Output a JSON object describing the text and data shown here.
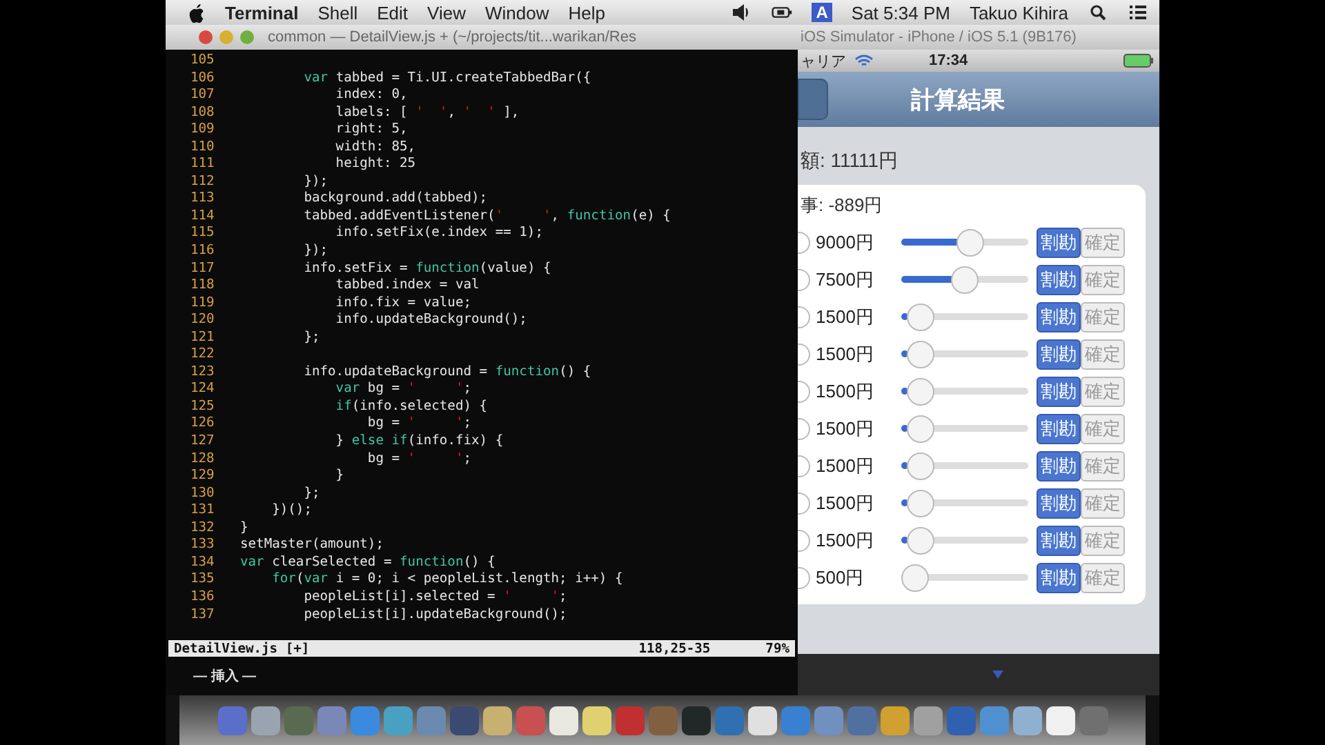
{
  "menu_bar": {
    "app": "Terminal",
    "menus": [
      "Shell",
      "Edit",
      "View",
      "Window",
      "Help"
    ],
    "input_indicator": "A",
    "clock": "Sat 5:34 PM",
    "user": "Takuo Kihira"
  },
  "terminal": {
    "title": "common — DetailView.js + (~/projects/tit...warikan/Res",
    "lines": [
      {
        "number": "105"
      },
      {
        "number": "106",
        "segments": [
          {
            "kind": "kw",
            "text": "        var"
          },
          {
            "kind": "plain",
            "text": " tabbed = Ti.UI.createTabbedBar({"
          }
        ]
      },
      {
        "number": "107",
        "segments": [
          {
            "kind": "plain",
            "text": "            index: 0,"
          }
        ]
      },
      {
        "number": "108",
        "segments": [
          {
            "kind": "plain",
            "text": "            labels: [ "
          },
          {
            "kind": "str",
            "text": "'  '"
          },
          {
            "kind": "plain",
            "text": ", "
          },
          {
            "kind": "str",
            "text": "'  '"
          },
          {
            "kind": "plain",
            "text": " ],"
          }
        ]
      },
      {
        "number": "109",
        "segments": [
          {
            "kind": "plain",
            "text": "            right: 5,"
          }
        ]
      },
      {
        "number": "110",
        "segments": [
          {
            "kind": "plain",
            "text": "            width: 85,"
          }
        ]
      },
      {
        "number": "111",
        "segments": [
          {
            "kind": "plain",
            "text": "            height: 25"
          }
        ]
      },
      {
        "number": "112",
        "segments": [
          {
            "kind": "plain",
            "text": "        });"
          }
        ]
      },
      {
        "number": "113",
        "segments": [
          {
            "kind": "plain",
            "text": "        background.add(tabbed);"
          }
        ]
      },
      {
        "number": "114",
        "segments": [
          {
            "kind": "plain",
            "text": "        tabbed.addEventListener("
          },
          {
            "kind": "str",
            "text": "'     '"
          },
          {
            "kind": "plain",
            "text": ", "
          },
          {
            "kind": "kw",
            "text": "function"
          },
          {
            "kind": "plain",
            "text": "(e) {"
          }
        ]
      },
      {
        "number": "115",
        "segments": [
          {
            "kind": "plain",
            "text": "            info.setFix(e.index == 1);"
          }
        ]
      },
      {
        "number": "116",
        "segments": [
          {
            "kind": "plain",
            "text": "        });"
          }
        ]
      },
      {
        "number": "117",
        "segments": [
          {
            "kind": "plain",
            "text": "        info.setFix = "
          },
          {
            "kind": "kw",
            "text": "function"
          },
          {
            "kind": "plain",
            "text": "(value) {"
          }
        ]
      },
      {
        "number": "118",
        "segments": [
          {
            "kind": "plain",
            "text": "            tabbed.index = val"
          }
        ]
      },
      {
        "number": "119",
        "segments": [
          {
            "kind": "plain",
            "text": "            info.fix = value;"
          }
        ]
      },
      {
        "number": "120",
        "segments": [
          {
            "kind": "plain",
            "text": "            info.updateBackground();"
          }
        ]
      },
      {
        "number": "121",
        "segments": [
          {
            "kind": "plain",
            "text": "        };"
          }
        ]
      },
      {
        "number": "122"
      },
      {
        "number": "123",
        "segments": [
          {
            "kind": "plain",
            "text": "        info.updateBackground = "
          },
          {
            "kind": "kw",
            "text": "function"
          },
          {
            "kind": "plain",
            "text": "() {"
          }
        ]
      },
      {
        "number": "124",
        "segments": [
          {
            "kind": "kw",
            "text": "            var"
          },
          {
            "kind": "plain",
            "text": " bg = "
          },
          {
            "kind": "str",
            "text": "'     '"
          },
          {
            "kind": "plain",
            "text": ";"
          }
        ]
      },
      {
        "number": "125",
        "segments": [
          {
            "kind": "kw",
            "text": "            if"
          },
          {
            "kind": "plain",
            "text": "(info.selected) {"
          }
        ]
      },
      {
        "number": "126",
        "segments": [
          {
            "kind": "plain",
            "text": "                bg = "
          },
          {
            "kind": "str",
            "text": "'     '"
          },
          {
            "kind": "plain",
            "text": ";"
          }
        ]
      },
      {
        "number": "127",
        "segments": [
          {
            "kind": "plain",
            "text": "            } "
          },
          {
            "kind": "kw",
            "text": "else if"
          },
          {
            "kind": "plain",
            "text": "(info.fix) {"
          }
        ]
      },
      {
        "number": "128",
        "segments": [
          {
            "kind": "plain",
            "text": "                bg = "
          },
          {
            "kind": "str",
            "text": "'     '"
          },
          {
            "kind": "plain",
            "text": ";"
          }
        ]
      },
      {
        "number": "129",
        "segments": [
          {
            "kind": "plain",
            "text": "            }"
          }
        ]
      },
      {
        "number": "130",
        "segments": [
          {
            "kind": "plain",
            "text": "        };"
          }
        ]
      },
      {
        "number": "131",
        "segments": [
          {
            "kind": "plain",
            "text": "    })();"
          }
        ]
      },
      {
        "number": "132",
        "segments": [
          {
            "kind": "plain",
            "text": "}"
          }
        ]
      },
      {
        "number": "133",
        "segments": [
          {
            "kind": "plain",
            "text": "setMaster(amount);"
          }
        ]
      },
      {
        "number": "134",
        "segments": [
          {
            "kind": "kw",
            "text": "var"
          },
          {
            "kind": "plain",
            "text": " clearSelected = "
          },
          {
            "kind": "kw",
            "text": "function"
          },
          {
            "kind": "plain",
            "text": "() {"
          }
        ]
      },
      {
        "number": "135",
        "segments": [
          {
            "kind": "kw",
            "text": "    for"
          },
          {
            "kind": "plain",
            "text": "("
          },
          {
            "kind": "kw",
            "text": "var"
          },
          {
            "kind": "plain",
            "text": " i = 0; i < peopleList.length; i++) {"
          }
        ]
      },
      {
        "number": "136",
        "segments": [
          {
            "kind": "plain",
            "text": "        peopleList[i].selected = "
          },
          {
            "kind": "str",
            "text": "'     '"
          },
          {
            "kind": "plain",
            "text": ";"
          }
        ]
      },
      {
        "number": "137",
        "segments": [
          {
            "kind": "plain",
            "text": "        peopleList[i].updateBackground();"
          }
        ]
      }
    ],
    "status_file": "DetailView.js [+]",
    "status_position": "118,25-35",
    "status_percent": "79%",
    "mode": "— 挿入 —"
  },
  "simulator": {
    "title": "iOS Simulator - iPhone / iOS 5.1 (9B176)",
    "carrier": "ャリア",
    "time": "17:34",
    "nav_title": "計算結果",
    "total": "額: 11111円",
    "organizer": "事: -889円",
    "rows": [
      {
        "amount": "9000円",
        "level": 0.55,
        "selected": false,
        "buttons": [
          {
            "label": "割勘",
            "selected": true
          },
          {
            "label": "確定",
            "selected": false
          }
        ]
      },
      {
        "amount": "7500円",
        "level": 0.5,
        "selected": false,
        "buttons": [
          {
            "label": "割勘",
            "selected": true
          },
          {
            "label": "確定",
            "selected": false
          }
        ]
      },
      {
        "amount": "1500円",
        "level": 0.05,
        "selected": false,
        "buttons": [
          {
            "label": "割勘",
            "selected": true
          },
          {
            "label": "確定",
            "selected": false
          }
        ]
      },
      {
        "amount": "1500円",
        "level": 0.05,
        "selected": false,
        "buttons": [
          {
            "label": "割勘",
            "selected": true
          },
          {
            "label": "確定",
            "selected": false
          }
        ]
      },
      {
        "amount": "1500円",
        "level": 0.05,
        "selected": false,
        "buttons": [
          {
            "label": "割勘",
            "selected": true
          },
          {
            "label": "確定",
            "selected": false
          }
        ]
      },
      {
        "amount": "1500円",
        "level": 0.05,
        "selected": false,
        "buttons": [
          {
            "label": "割勘",
            "selected": true
          },
          {
            "label": "確定",
            "selected": false
          }
        ]
      },
      {
        "amount": "1500円",
        "level": 0.05,
        "selected": false,
        "buttons": [
          {
            "label": "割勘",
            "selected": true
          },
          {
            "label": "確定",
            "selected": false
          }
        ]
      },
      {
        "amount": "1500円",
        "level": 0.05,
        "selected": false,
        "buttons": [
          {
            "label": "割勘",
            "selected": true
          },
          {
            "label": "確定",
            "selected": false
          }
        ]
      },
      {
        "amount": "1500円",
        "level": 0.05,
        "selected": false,
        "buttons": [
          {
            "label": "割勘",
            "selected": true
          },
          {
            "label": "確定",
            "selected": false
          }
        ]
      },
      {
        "amount": "500円",
        "level": 0.0,
        "selected": false,
        "buttons": [
          {
            "label": "割勘",
            "selected": true
          },
          {
            "label": "確定",
            "selected": false
          }
        ]
      }
    ]
  },
  "dock": [
    {
      "color": "#5a6fc8"
    },
    {
      "color": "#9aa4b0"
    },
    {
      "color": "#5a6a50"
    },
    {
      "color": "#7a88b8"
    },
    {
      "color": "#3a8ae0"
    },
    {
      "color": "#4aa0c0"
    },
    {
      "color": "#6a8ab0"
    },
    {
      "color": "#3a4a70"
    },
    {
      "color": "#c8b070"
    },
    {
      "color": "#c85050"
    },
    {
      "color": "#e8e8e0"
    },
    {
      "color": "#e0d070"
    },
    {
      "color": "#c03030"
    },
    {
      "color": "#806040"
    },
    {
      "color": "#202828"
    },
    {
      "color": "#3070b0"
    },
    {
      "color": "#e0e0e0"
    },
    {
      "color": "#3a80d0"
    },
    {
      "color": "#7090c0"
    },
    {
      "color": "#5070a0"
    },
    {
      "color": "#d0a030"
    },
    {
      "color": "#a0a0a0"
    },
    {
      "color": "#3060b0"
    },
    {
      "color": "#5090d0"
    },
    {
      "color": "#90b0d0"
    },
    {
      "color": "#f0f0f0"
    },
    {
      "color": "#707070"
    }
  ]
}
